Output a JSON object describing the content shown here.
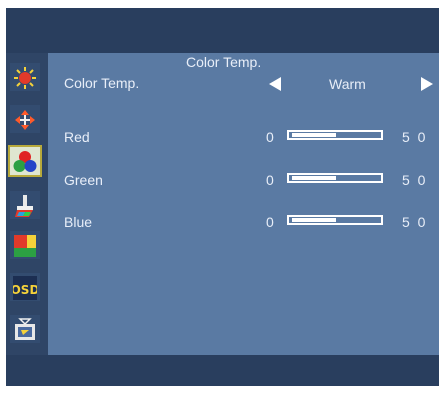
{
  "menu": {
    "title": "Color Temp.",
    "sidebar": [
      {
        "icon": "brightness-icon",
        "active": false
      },
      {
        "icon": "position-icon",
        "active": false
      },
      {
        "icon": "color-icon",
        "active": true
      },
      {
        "icon": "image-setup-icon",
        "active": false
      },
      {
        "icon": "color-boost-icon",
        "active": false
      },
      {
        "icon": "osd-icon",
        "active": false
      },
      {
        "icon": "extra-icon",
        "active": false
      }
    ],
    "rows": {
      "color_temp": {
        "label": "Color Temp.",
        "value": "Warm"
      },
      "red": {
        "label": "Red",
        "min": "0",
        "max": "5 0",
        "level": 0.5
      },
      "green": {
        "label": "Green",
        "min": "0",
        "max": "5 0",
        "level": 0.5
      },
      "blue": {
        "label": "Blue",
        "min": "0",
        "max": "5 0",
        "level": 0.5
      }
    }
  },
  "colors": {
    "frame": "#293e5e",
    "panel": "#5a7aa3",
    "text": "#e8eef8",
    "active_highlight": "#b7a93b"
  }
}
